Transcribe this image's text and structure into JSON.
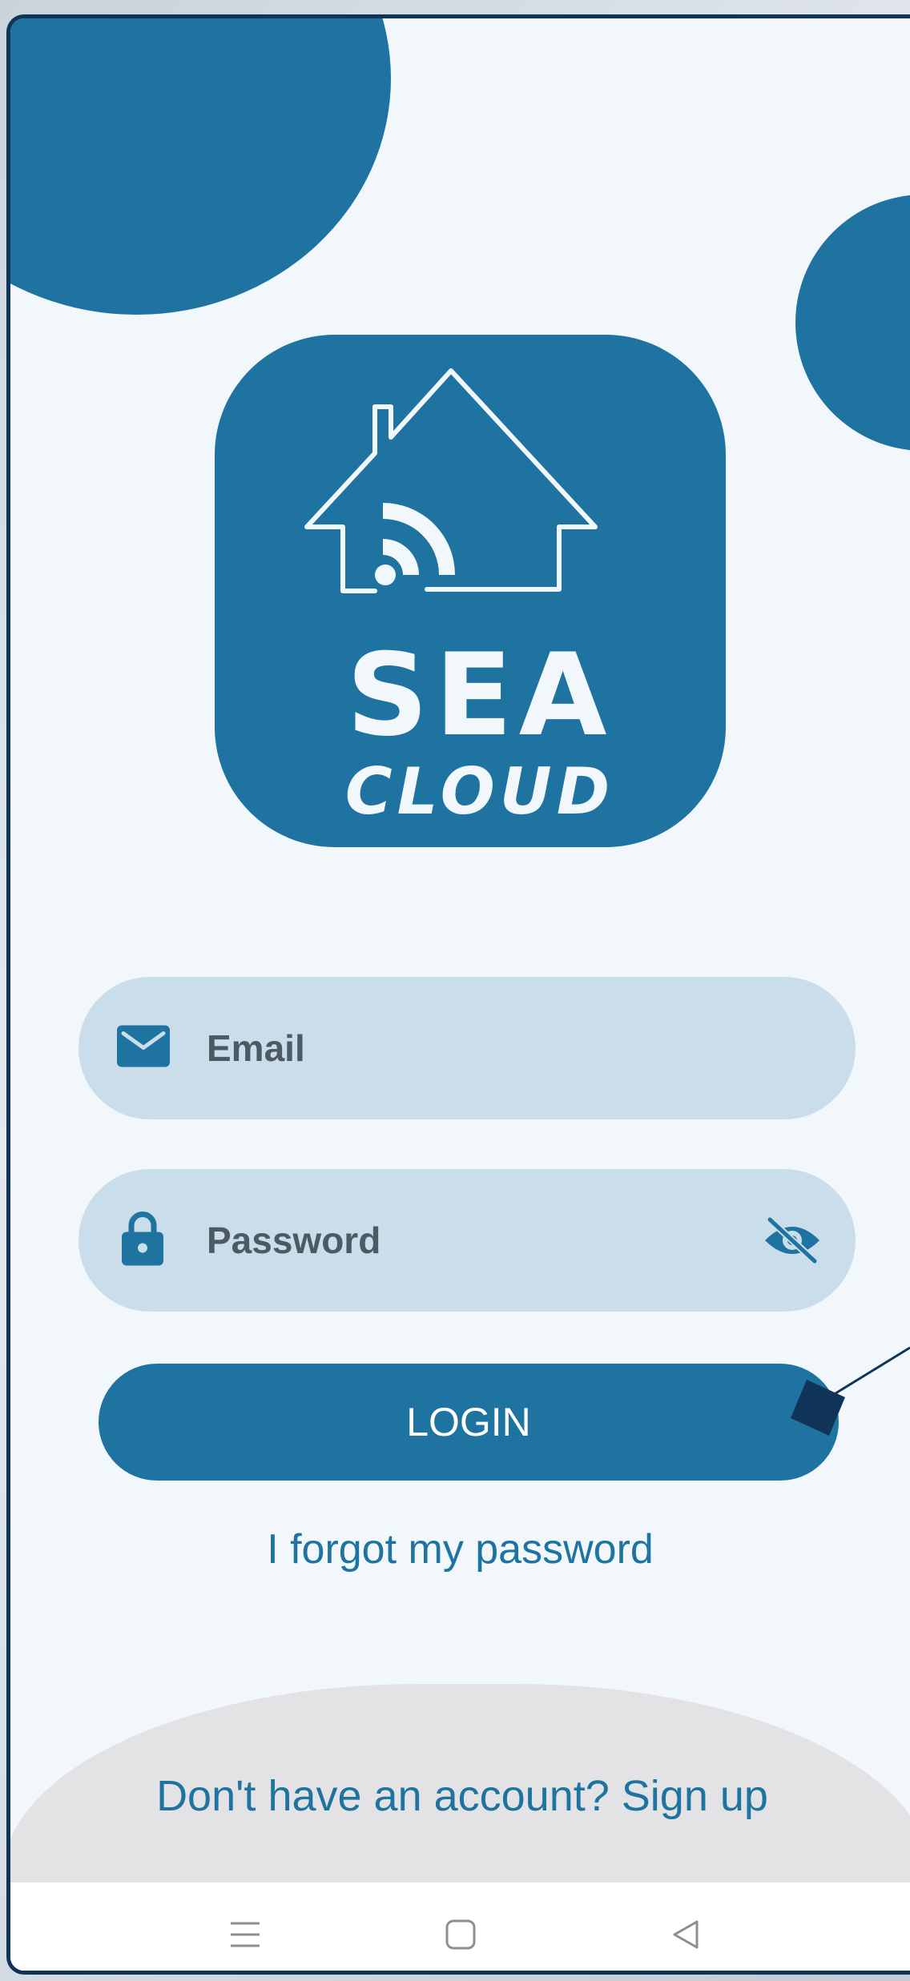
{
  "theme": {
    "primary": "#1e73a0",
    "background": "#f2f7fc",
    "field_bg": "#c9deea",
    "footer_bg": "#e3e3e5",
    "frame": "#0f3457"
  },
  "logo": {
    "line1": "SEA",
    "line2": "CLOUD",
    "icon": "smart-home-wifi-icon"
  },
  "form": {
    "email_placeholder": "Email",
    "email_icon": "mail-icon",
    "password_placeholder": "Password",
    "password_icon": "lock-icon",
    "visibility_icon": "eye-off-icon",
    "login_label": "LOGIN",
    "forgot_label": "I forgot my password"
  },
  "footer": {
    "signup_label": "Don't have an account? Sign up"
  },
  "navbar": {
    "menu_icon": "menu-icon",
    "home_icon": "home-square-icon",
    "back_icon": "back-triangle-icon"
  }
}
